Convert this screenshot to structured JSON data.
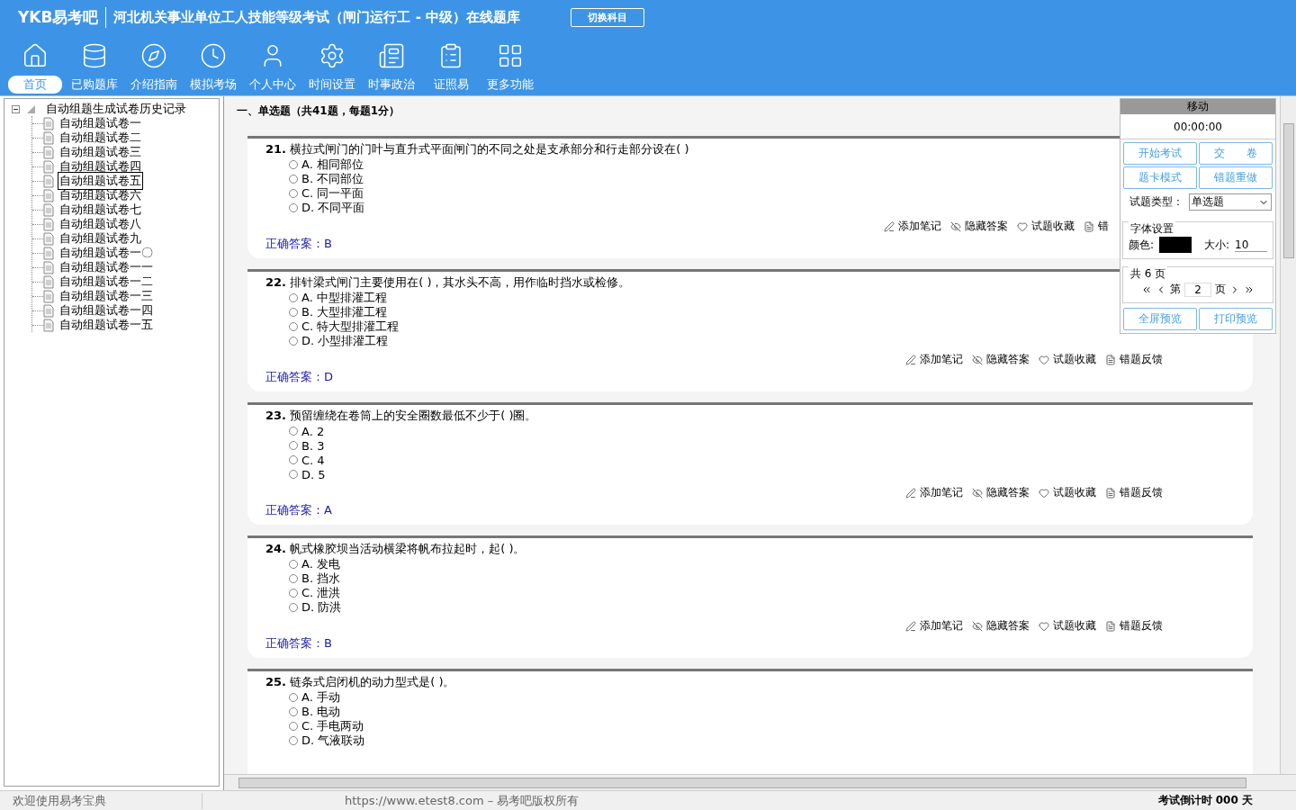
{
  "header": {
    "logo": "YKB易考吧",
    "title": "河北机关事业单位工人技能等级考试（闸门运行工 - 中级）在线题库",
    "switch_button": "切换科目"
  },
  "nav": [
    {
      "label": "首页",
      "selected": true
    },
    {
      "label": "已购题库",
      "selected": false
    },
    {
      "label": "介绍指南",
      "selected": false
    },
    {
      "label": "模拟考场",
      "selected": false
    },
    {
      "label": "个人中心",
      "selected": false
    },
    {
      "label": "时间设置",
      "selected": false
    },
    {
      "label": "时事政治",
      "selected": false
    },
    {
      "label": "证照易",
      "selected": false
    },
    {
      "label": "更多功能",
      "selected": false
    }
  ],
  "tree": {
    "label": "自动组题生成试卷历史记录",
    "expanded": true,
    "children": [
      {
        "label": "自动组题试卷一",
        "selected": false
      },
      {
        "label": "自动组题试卷二",
        "selected": false
      },
      {
        "label": "自动组题试卷三",
        "selected": false
      },
      {
        "label": "自动组题试卷四",
        "selected": false
      },
      {
        "label": "自动组题试卷五",
        "selected": true
      },
      {
        "label": "自动组题试卷六",
        "selected": false
      },
      {
        "label": "自动组题试卷七",
        "selected": false
      },
      {
        "label": "自动组题试卷八",
        "selected": false
      },
      {
        "label": "自动组题试卷九",
        "selected": false
      },
      {
        "label": "自动组题试卷一〇",
        "selected": false
      },
      {
        "label": "自动组题试卷一一",
        "selected": false
      },
      {
        "label": "自动组题试卷一二",
        "selected": false
      },
      {
        "label": "自动组题试卷一三",
        "selected": false
      },
      {
        "label": "自动组题试卷一四",
        "selected": false
      },
      {
        "label": "自动组题试卷一五",
        "selected": false
      }
    ]
  },
  "section_title": "一、单选题（共41题，每题1分）",
  "questions": [
    {
      "number": "21.",
      "text": "横拉式闸门的门叶与直升式平面闸门的不同之处是支承部分和行走部分设在( )",
      "options": [
        {
          "letter": "A.",
          "text": "相同部位",
          "selected": false
        },
        {
          "letter": "B.",
          "text": "不同部位",
          "selected": false
        },
        {
          "letter": "C.",
          "text": "同一平面",
          "selected": false
        },
        {
          "letter": "D.",
          "text": "不同平面",
          "selected": false
        }
      ],
      "actions": [
        "添加笔记",
        "隐藏答案",
        "试题收藏",
        "错"
      ],
      "answer_label": "正确答案：",
      "answer": "B"
    },
    {
      "number": "22.",
      "text": "排针梁式闸门主要使用在( )，其水头不高，用作临时挡水或检修。",
      "options": [
        {
          "letter": "A.",
          "text": "中型排灌工程",
          "selected": false
        },
        {
          "letter": "B.",
          "text": "大型排灌工程",
          "selected": false
        },
        {
          "letter": "C.",
          "text": "特大型排灌工程",
          "selected": false
        },
        {
          "letter": "D.",
          "text": "小型排灌工程",
          "selected": false
        }
      ],
      "actions": [
        "添加笔记",
        "隐藏答案",
        "试题收藏",
        "错题反馈"
      ],
      "answer_label": "正确答案：",
      "answer": "D"
    },
    {
      "number": "23.",
      "text": "预留缠绕在卷筒上的安全圈数最低不少于( )圈。",
      "options": [
        {
          "letter": "A.",
          "text": "2",
          "selected": false
        },
        {
          "letter": "B.",
          "text": "3",
          "selected": false
        },
        {
          "letter": "C.",
          "text": "4",
          "selected": false
        },
        {
          "letter": "D.",
          "text": "5",
          "selected": false
        }
      ],
      "actions": [
        "添加笔记",
        "隐藏答案",
        "试题收藏",
        "错题反馈"
      ],
      "answer_label": "正确答案：",
      "answer": "A"
    },
    {
      "number": "24.",
      "text": "帆式橡胶坝当活动横梁将帆布拉起时，起( )。",
      "options": [
        {
          "letter": "A.",
          "text": "发电",
          "selected": false
        },
        {
          "letter": "B.",
          "text": "挡水",
          "selected": false
        },
        {
          "letter": "C.",
          "text": "泄洪",
          "selected": false
        },
        {
          "letter": "D.",
          "text": "防洪",
          "selected": false
        }
      ],
      "actions": [
        "添加笔记",
        "隐藏答案",
        "试题收藏",
        "错题反馈"
      ],
      "answer_label": "正确答案：",
      "answer": "B"
    },
    {
      "number": "25.",
      "text": "链条式启闭机的动力型式是( )。",
      "options": [
        {
          "letter": "A.",
          "text": "手动",
          "selected": false
        },
        {
          "letter": "B.",
          "text": "电动",
          "selected": false
        },
        {
          "letter": "C.",
          "text": "手电两动",
          "selected": false
        },
        {
          "letter": "D.",
          "text": "气液联动",
          "selected": false
        }
      ]
    }
  ],
  "panel": {
    "title": "移动",
    "timer": "00:00:00",
    "buttons": [
      "开始考试",
      "交　　卷",
      "题卡模式",
      "错题重做"
    ],
    "type_label": "试题类型：",
    "type_value": "单选题",
    "font_group": "字体设置",
    "color_label": "颜色:",
    "color": "#000000",
    "size_label": "大小:",
    "size": "10",
    "page_group": "共 6 页",
    "page_prefix": "第",
    "page": "2",
    "page_suffix": "页",
    "bottom_buttons": [
      "全屏预览",
      "打印预览"
    ]
  },
  "status_bar": {
    "welcome": "欢迎使用易考宝典",
    "copyright": "https://www.etest8.com – 易考吧版权所有",
    "countdown": "考试倒计时 000 天"
  }
}
